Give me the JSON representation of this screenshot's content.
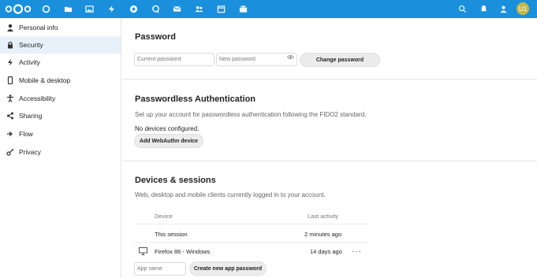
{
  "header": {
    "apps": [
      {
        "name": "dashboard-icon"
      },
      {
        "name": "files-icon"
      },
      {
        "name": "photos-icon"
      },
      {
        "name": "activity-icon"
      },
      {
        "name": "talk-icon"
      },
      {
        "name": "search-bubble-icon"
      },
      {
        "name": "mail-icon"
      },
      {
        "name": "contacts-icon"
      },
      {
        "name": "calendar-icon"
      },
      {
        "name": "deck-icon"
      }
    ],
    "avatar_initials": "U1"
  },
  "sidebar": {
    "items": [
      {
        "label": "Personal info",
        "icon": "person-icon"
      },
      {
        "label": "Security",
        "icon": "lock-icon",
        "active": true
      },
      {
        "label": "Activity",
        "icon": "activity-icon"
      },
      {
        "label": "Mobile & desktop",
        "icon": "phone-icon"
      },
      {
        "label": "Accessibility",
        "icon": "accessibility-icon"
      },
      {
        "label": "Sharing",
        "icon": "share-icon"
      },
      {
        "label": "Flow",
        "icon": "flow-icon"
      },
      {
        "label": "Privacy",
        "icon": "key-icon"
      }
    ]
  },
  "password": {
    "title": "Password",
    "current_placeholder": "Current password",
    "new_placeholder": "New password",
    "change_button": "Change password"
  },
  "passwordless": {
    "title": "Passwordless Authentication",
    "description": "Set up your account for passwordless authentication following the FIDO2 standard.",
    "status": "No devices configured.",
    "add_button": "Add WebAuthn device"
  },
  "devices": {
    "title": "Devices & sessions",
    "description": "Web, desktop and mobile clients currently logged in to your account.",
    "columns": {
      "device": "Device",
      "last_activity": "Last activity"
    },
    "rows": [
      {
        "device": "This session",
        "last_activity": "2 minutes ago"
      },
      {
        "device": "Firefox 86 - Windows",
        "last_activity": "14 days ago",
        "more": "···"
      }
    ],
    "app_name_placeholder": "App name",
    "create_button": "Create new app password"
  },
  "colors": {
    "header": "#1a90dc",
    "active_nav": "#e8f1fa",
    "avatar": "#c7b74a"
  }
}
